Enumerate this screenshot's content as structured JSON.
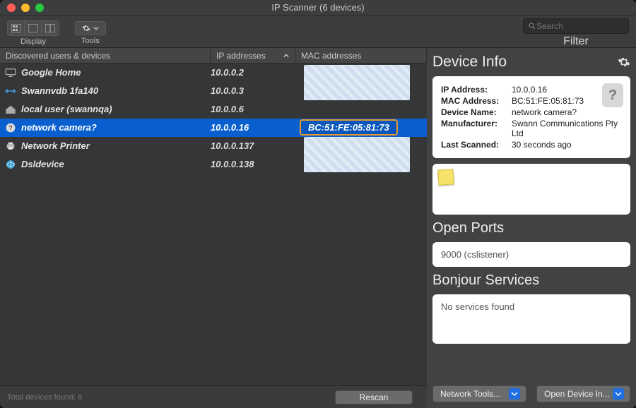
{
  "window": {
    "title": "IP Scanner (6 devices)"
  },
  "toolbar": {
    "display_label": "Display",
    "tools_label": "Tools",
    "filter_label": "Filter",
    "search_placeholder": "Search"
  },
  "columns": {
    "devices": "Discovered users & devices",
    "ip": "IP addresses",
    "mac": "MAC addresses"
  },
  "devices": [
    {
      "icon": "monitor",
      "name": "Google Home",
      "ip": "10.0.0.2",
      "mac": ""
    },
    {
      "icon": "switch",
      "name": "Swannvdb 1fa140",
      "ip": "10.0.0.3",
      "mac": ""
    },
    {
      "icon": "house",
      "name": "local user (swannqa)",
      "ip": "10.0.0.6",
      "mac": ""
    },
    {
      "icon": "question",
      "name": "network camera?",
      "ip": "10.0.0.16",
      "mac": "BC:51:FE:05:81:73",
      "selected": true,
      "highlight_mac": true
    },
    {
      "icon": "printer",
      "name": "Network Printer",
      "ip": "10.0.0.137",
      "mac": ""
    },
    {
      "icon": "globe",
      "name": "Dsldevice",
      "ip": "10.0.0.138",
      "mac": ""
    }
  ],
  "info": {
    "title": "Device Info",
    "ip_label": "IP Address:",
    "ip": "10.0.0.16",
    "mac_label": "MAC Address:",
    "mac": "BC:51:FE:05:81:73",
    "name_label": "Device Name:",
    "name": "network camera?",
    "mfg_label": "Manufacturer:",
    "mfg": "Swann Communications Pty Ltd",
    "scan_label": "Last Scanned:",
    "scan": "30 seconds ago"
  },
  "ports": {
    "title": "Open Ports",
    "text": "9000 (cslistener)"
  },
  "bonjour": {
    "title": "Bonjour Services",
    "text": "No services found"
  },
  "buttons": {
    "network_tools": "Network Tools...",
    "open_device": "Open Device In...",
    "rescan": "Rescan"
  },
  "status": {
    "total": "Total devices found: 6"
  }
}
